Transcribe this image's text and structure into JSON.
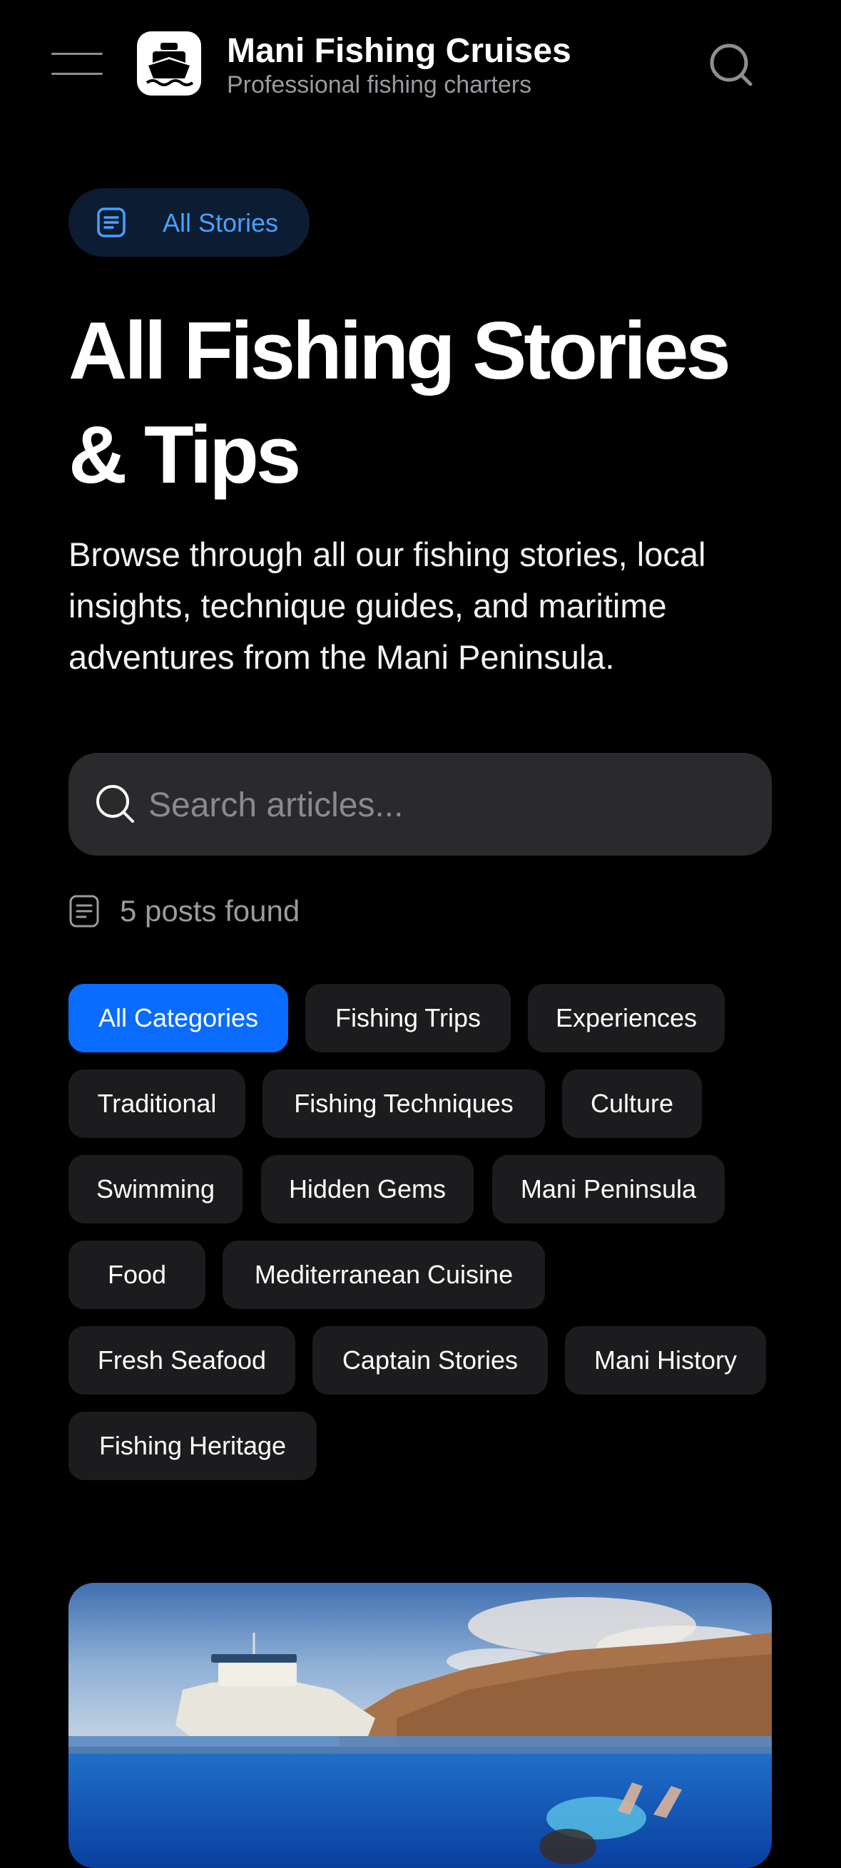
{
  "header": {
    "title": "Mani Fishing Cruises",
    "subtitle": "Professional fishing charters",
    "menu_icon": "hamburger-icon",
    "logo_icon": "boat-icon",
    "search_icon": "search-icon"
  },
  "badge": {
    "label": "All Stories",
    "icon": "document-icon"
  },
  "page": {
    "title": "All Fishing Stories & Tips",
    "intro": "Browse through all our fishing stories, local insights, technique guides, and maritime adventures from the Mani Peninsula."
  },
  "search": {
    "placeholder": "Search articles..."
  },
  "results": {
    "count_label": "5 posts found"
  },
  "categories": [
    "All Categories",
    "Fishing Trips",
    "Experiences",
    "Traditional",
    "Fishing Techniques",
    "Culture",
    "Swimming",
    "Hidden Gems",
    "Mani Peninsula",
    "Food",
    "Mediterranean Cuisine",
    "Fresh Seafood",
    "Captain Stories",
    "Mani History",
    "Fishing Heritage"
  ],
  "active_category": "All Categories",
  "colors": {
    "accent": "#0a6cff",
    "badge_text": "#4aa0ff",
    "chip_bg": "#1c1c1e"
  }
}
